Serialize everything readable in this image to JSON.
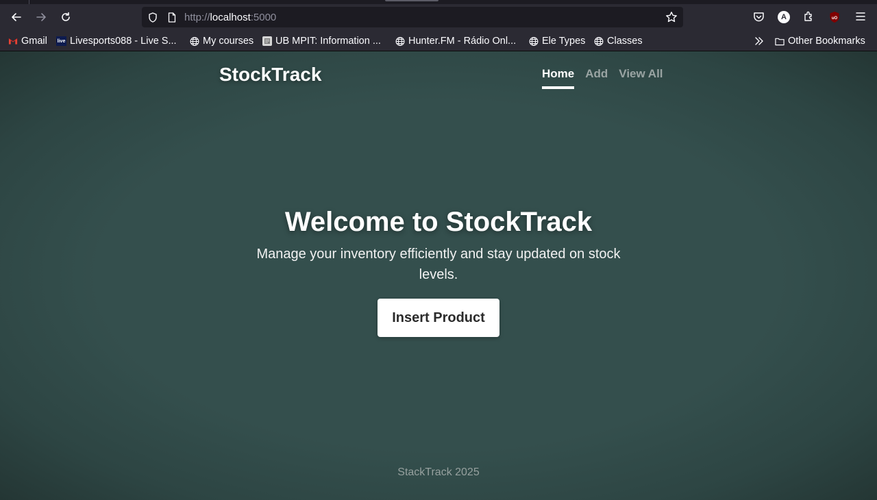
{
  "browser": {
    "url_prefix": "http://",
    "url_host": "localhost",
    "url_port": ":5000",
    "bookmarks": [
      {
        "label": "Gmail",
        "icon": "gmail-icon"
      },
      {
        "label": "Livesports088 - Live S...",
        "icon": "livesports-icon"
      },
      {
        "label": "My courses",
        "icon": "globe-icon"
      },
      {
        "label": "UB MPIT: Information ...",
        "icon": "doc-icon"
      },
      {
        "label": "Hunter.FM - Rádio Onl...",
        "icon": "globe-icon"
      },
      {
        "label": "Ele Types",
        "icon": "globe-icon"
      },
      {
        "label": "Classes",
        "icon": "globe-icon"
      }
    ],
    "other_bookmarks": "Other Bookmarks",
    "profile_letter": "A"
  },
  "site": {
    "brand": "StockTrack",
    "nav": [
      {
        "label": "Home",
        "active": true
      },
      {
        "label": "Add",
        "active": false
      },
      {
        "label": "View All",
        "active": false
      }
    ],
    "hero": {
      "title": "Welcome to StockTrack",
      "subtitle": "Manage your inventory efficiently and stay updated on stock levels.",
      "cta": "Insert Product"
    },
    "footer": "StackTrack 2025"
  },
  "colors": {
    "page_bg": "#344f4d",
    "chrome_bg": "#2b2a33",
    "cta_bg": "#ffffff"
  }
}
